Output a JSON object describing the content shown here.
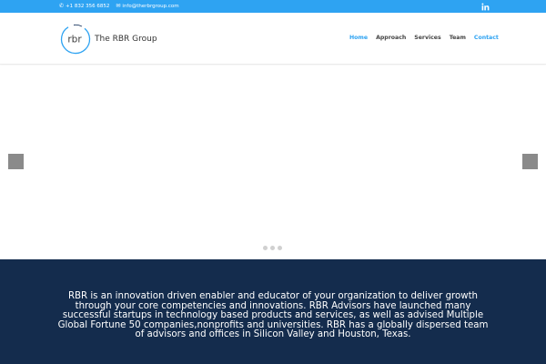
{
  "topbar": {
    "phone": "+1 832 356 6852",
    "email": "info@therbrgroup.com",
    "icons": {
      "phone": "phone-icon",
      "email": "envelope-icon",
      "social": "linkedin-icon"
    },
    "color": "#2ea3f2"
  },
  "header": {
    "logo_mark": "rbr",
    "logo_text": "The RBR Group",
    "nav": [
      {
        "label": "Home",
        "state": "active"
      },
      {
        "label": "Approach",
        "state": "normal"
      },
      {
        "label": "Services",
        "state": "normal"
      },
      {
        "label": "Team",
        "state": "normal"
      },
      {
        "label": "Contact",
        "state": "highlighted"
      }
    ]
  },
  "slider": {
    "prev_icon": "prev-arrow-icon",
    "next_icon": "next-arrow-icon",
    "slide_count": 3
  },
  "about": {
    "text": "RBR is an innovation driven enabler and educator of your organization to deliver growth through your core competencies and innovations.  RBR Advisors have launched many successful startups in technology based products and services, as well as advised Multiple Global Fortune 50 companies,nonprofits and universities.   RBR has a globally dispersed team of advisors and offices in Silicon Valley and Houston, Texas.",
    "background": "#142c4d"
  }
}
